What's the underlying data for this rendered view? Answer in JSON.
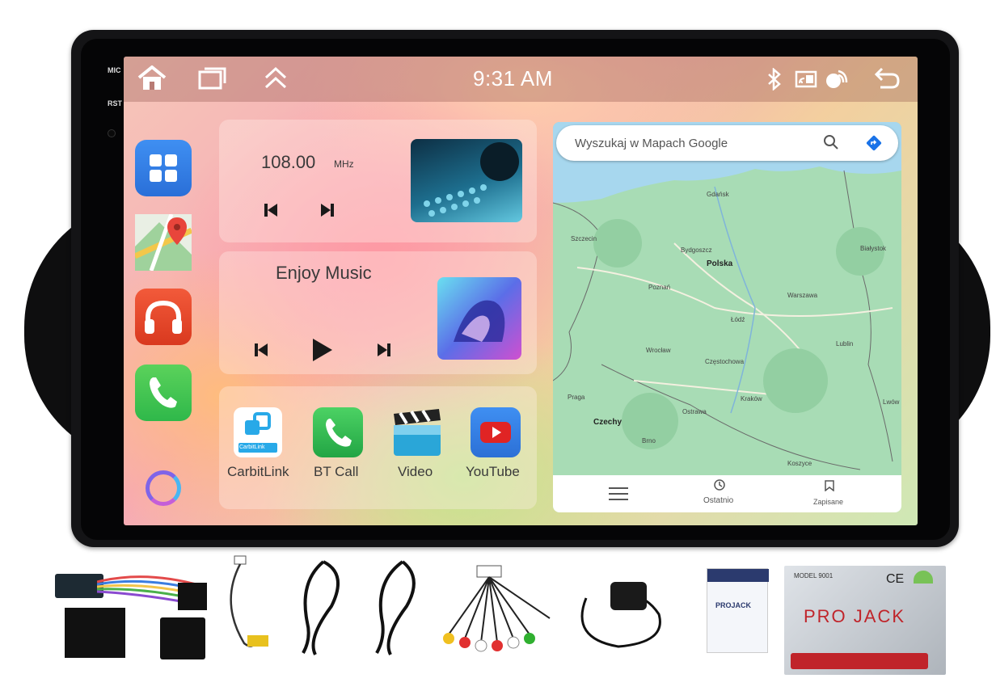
{
  "hardware": {
    "mic_label": "MIC",
    "rst_label": "RST"
  },
  "statusbar": {
    "time": "9:31 AM",
    "left_icons": [
      "home-icon",
      "recent-apps-icon",
      "chevron-up-icon"
    ],
    "right_icons": [
      "bluetooth-icon",
      "screen-cast-icon",
      "wireless-link-icon",
      "back-icon"
    ]
  },
  "dock": {
    "apps": [
      "apps-grid-icon",
      "maps-app-icon",
      "music-app-icon",
      "phone-app-icon",
      "voice-assistant-icon"
    ]
  },
  "radio": {
    "frequency": "108.00",
    "unit": "MHz"
  },
  "music": {
    "title": "Enjoy Music"
  },
  "shortcuts": [
    {
      "label": "CarbitLink",
      "icon": "carbitlink-icon",
      "icon_badge": "CarbitLink"
    },
    {
      "label": "BT Call",
      "icon": "phone-icon"
    },
    {
      "label": "Video",
      "icon": "clapperboard-icon"
    },
    {
      "label": "YouTube",
      "icon": "youtube-icon"
    }
  ],
  "map": {
    "search_placeholder": "Wyszukaj w Mapach Google",
    "nav": {
      "recent": "Ostatnio",
      "saved": "Zapisane"
    },
    "cities": {
      "gdansk": "Gdańsk",
      "szczecin": "Szczecin",
      "bydgoszcz": "Bydgoszcz",
      "polska": "Polska",
      "poznan": "Poznań",
      "warszawa": "Warszawa",
      "bialystok": "Białystok",
      "lodz": "Łódź",
      "lublin": "Lublin",
      "wroclaw": "Wrocław",
      "czestochowa": "Częstochowa",
      "krakow": "Kraków",
      "praga": "Praga",
      "ostrawa": "Ostrawa",
      "czechy": "Czechy",
      "brno": "Brno",
      "koszyce": "Koszyce",
      "lwow": "Lwów"
    }
  },
  "accessories": {
    "manual_brand": "PROJACK",
    "box": {
      "model": "MODEL 9001",
      "brand": "PRO  JACK",
      "mark": "CE"
    }
  },
  "colors": {
    "accent_blue": "#2f7fe9",
    "music_red": "#e8452f",
    "phone_green": "#2fb84a",
    "youtube_red": "#e02424"
  }
}
